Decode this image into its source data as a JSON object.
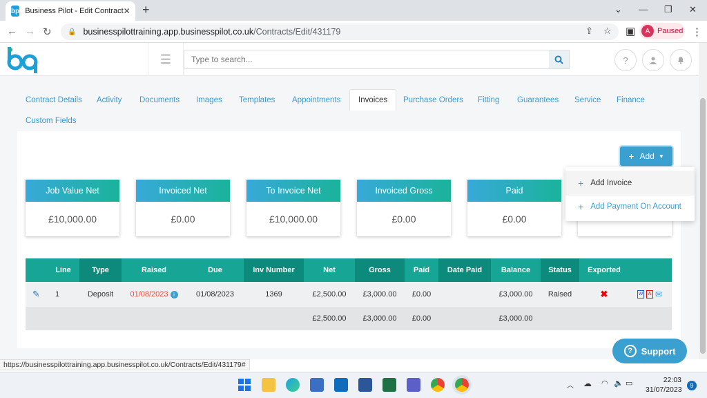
{
  "browser": {
    "tab_title": "Business Pilot - Edit Contract",
    "favicon_text": "bp",
    "url_host": "businesspilottraining.app.businesspilot.co.uk",
    "url_path": "/Contracts/Edit/431179",
    "profile_initial": "A",
    "profile_status": "Paused",
    "status_url": "https://businesspilottraining.app.businesspilot.co.uk/Contracts/Edit/431179#"
  },
  "header": {
    "search_placeholder": "Type to search..."
  },
  "tabs": [
    {
      "label": "Contract Details"
    },
    {
      "label": "Activity"
    },
    {
      "label": "Documents"
    },
    {
      "label": "Images"
    },
    {
      "label": "Templates"
    },
    {
      "label": "Appointments"
    },
    {
      "label": "Invoices"
    },
    {
      "label": "Purchase Orders"
    },
    {
      "label": "Fitting"
    },
    {
      "label": "Guarantees"
    },
    {
      "label": "Service"
    },
    {
      "label": "Finance"
    },
    {
      "label": "Custom Fields"
    }
  ],
  "active_tab": "Invoices",
  "add_button": "Add",
  "dropdown": {
    "items": [
      {
        "label": "Add Invoice"
      },
      {
        "label": "Add Payment On Account"
      }
    ]
  },
  "summary_cards": [
    {
      "title": "Job Value Net",
      "value": "£10,000.00"
    },
    {
      "title": "Invoiced Net",
      "value": "£0.00"
    },
    {
      "title": "To Invoice Net",
      "value": "£10,000.00"
    },
    {
      "title": "Invoiced Gross",
      "value": "£0.00"
    },
    {
      "title": "Paid",
      "value": "£0.00"
    }
  ],
  "table": {
    "headers": [
      "Line",
      "Type",
      "Raised",
      "Due",
      "Inv Number",
      "Net",
      "Gross",
      "Paid",
      "Date Paid",
      "Balance",
      "Status",
      "Exported"
    ],
    "rows": [
      {
        "line": "1",
        "type": "Deposit",
        "raised": "01/08/2023",
        "due": "01/08/2023",
        "inv_number": "1369",
        "net": "£2,500.00",
        "gross": "£3,000.00",
        "paid": "£0.00",
        "date_paid": "",
        "balance": "£3,000.00",
        "status": "Raised"
      }
    ],
    "totals": {
      "net": "£2,500.00",
      "gross": "£3,000.00",
      "paid": "£0.00",
      "balance": "£3,000.00"
    }
  },
  "support_label": "Support",
  "taskbar": {
    "time": "22:03",
    "date": "31/07/2023",
    "notif_count": "9"
  },
  "colors": {
    "accent": "#3aa0d0",
    "teal": "#1ab39a",
    "header_dark": "#0e8a7c",
    "header_light": "#17a595",
    "raised_red": "#e74c3c"
  }
}
